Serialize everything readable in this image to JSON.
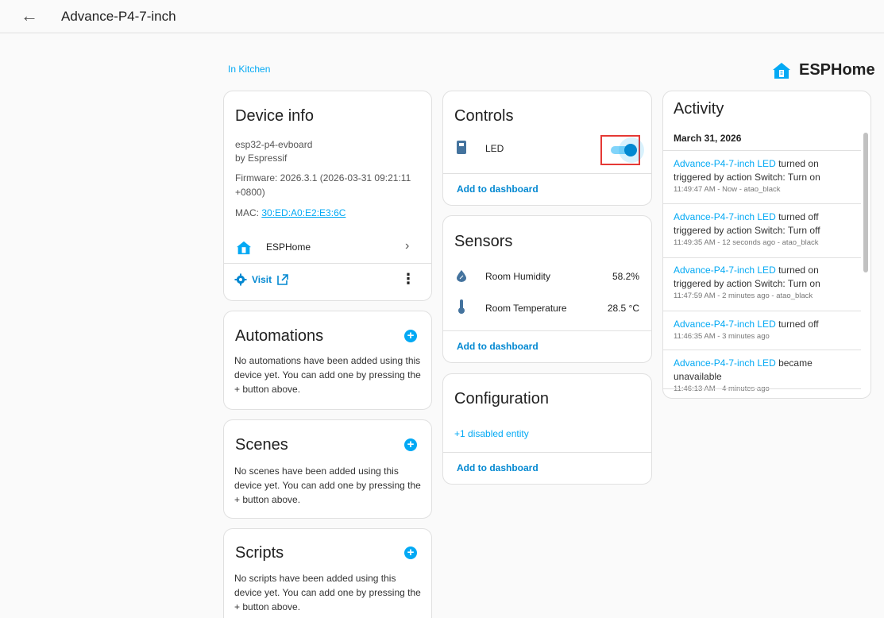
{
  "header": {
    "title": "Advance-P4-7-inch",
    "back_icon": "arrow-left-icon"
  },
  "area_link": "In Kitchen",
  "brand": {
    "name": "ESPHome",
    "icon": "esphome-house-icon",
    "color": "#03a9f4"
  },
  "device_info": {
    "title": "Device info",
    "model": "esp32-p4-evboard",
    "manufacturer": "by Espressif",
    "firmware": "Firmware: 2026.3.1 (2026-03-31 09:21:11 +0800)",
    "mac_label": "MAC:",
    "mac_value": "30:ED:A0:E2:E3:6C",
    "integration": "ESPHome",
    "visit_label": "Visit"
  },
  "automations": {
    "title": "Automations",
    "text": "No automations have been added using this device yet. You can add one by pressing the + button above."
  },
  "scenes": {
    "title": "Scenes",
    "text": "No scenes have been added using this device yet. You can add one by pressing the + button above."
  },
  "scripts": {
    "title": "Scripts",
    "text": "No scripts have been added using this device yet. You can add one by pressing the + button above."
  },
  "controls": {
    "title": "Controls",
    "led_label": "LED",
    "led_state": "on",
    "add_to_dashboard": "Add to dashboard"
  },
  "sensors": {
    "title": "Sensors",
    "items": [
      {
        "name": "Room Humidity",
        "value": "58.2%",
        "icon": "water-percent-icon"
      },
      {
        "name": "Room Temperature",
        "value": "28.5 °C",
        "icon": "thermometer-icon"
      }
    ],
    "add_to_dashboard": "Add to dashboard"
  },
  "configuration": {
    "title": "Configuration",
    "disabled_entity": "+1 disabled entity",
    "add_to_dashboard": "Add to dashboard"
  },
  "activity": {
    "title": "Activity",
    "date": "March 31, 2026",
    "entries": [
      {
        "entity": "Advance-P4-7-inch LED",
        "text": " turned on triggered by action Switch: Turn on",
        "meta": "11:49:47 AM - Now - atao_black"
      },
      {
        "entity": "Advance-P4-7-inch LED",
        "text": " turned off triggered by action Switch: Turn off",
        "meta": "11:49:35 AM - 12 seconds ago - atao_black"
      },
      {
        "entity": "Advance-P4-7-inch LED",
        "text": " turned on triggered by action Switch: Turn on",
        "meta": "11:47:59 AM - 2 minutes ago - atao_black"
      },
      {
        "entity": "Advance-P4-7-inch LED",
        "text": " turned off",
        "meta": "11:46:35 AM - 3 minutes ago"
      },
      {
        "entity": "Advance-P4-7-inch LED",
        "text": " became unavailable",
        "meta": "11:46:13 AM - 4 minutes ago"
      }
    ]
  },
  "colors": {
    "accent": "#03a9f4",
    "highlight_box": "#e53935"
  }
}
